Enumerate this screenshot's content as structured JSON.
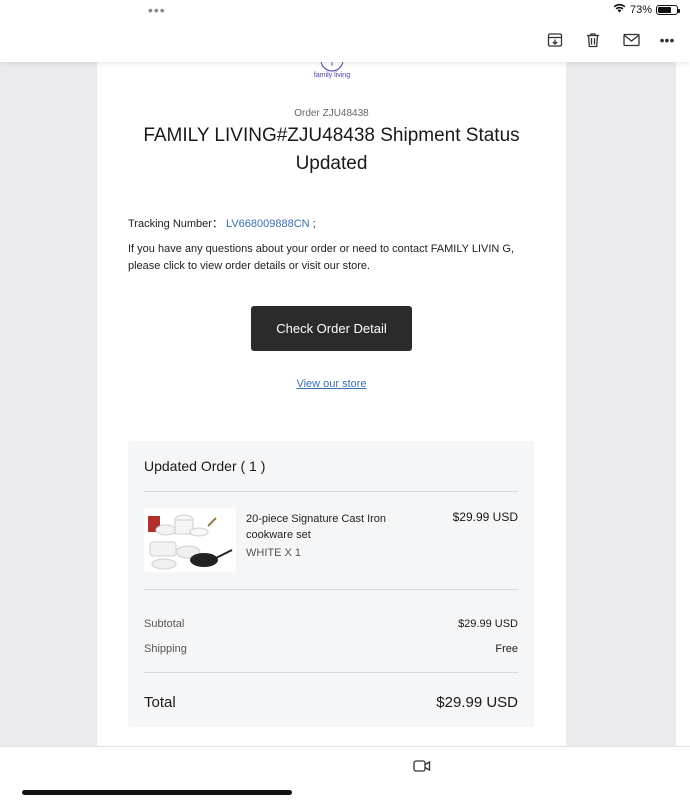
{
  "status_bar": {
    "dots": "•••",
    "battery_percent": "73%",
    "battery_level": 0.73
  },
  "toolbar": {
    "icons": [
      "archive-download-icon",
      "trash-icon",
      "envelope-icon",
      "more-icon"
    ],
    "more_label": "•••"
  },
  "email": {
    "logo_text": "family living",
    "order_line": "Order ZJU48438",
    "title": "FAMILY LIVING#ZJU48438 Shipment Status Updated",
    "tracking_label": "Tracking Number：",
    "tracking_number": "LV668009888CN",
    "tracking_suffix": " ;",
    "paragraph": "If you have any questions about your order or need to contact FAMILY LIVIN G, please click to view order details or visit our store.",
    "button_label": "Check Order Detail",
    "store_link": "View our store"
  },
  "order_card": {
    "title": "Updated Order ( 1 )",
    "item": {
      "name": "20-piece Signature Cast Iron cookware set",
      "price": "$29.99 USD",
      "variant": "WHITE X 1"
    },
    "subtotal_label": "Subtotal",
    "subtotal_value": "$29.99 USD",
    "shipping_label": "Shipping",
    "shipping_value": "Free",
    "total_label": "Total",
    "total_value": "$29.99 USD"
  },
  "bottom_bar": {
    "icons": [
      "video-camera-icon"
    ]
  },
  "colors": {
    "link": "#3a6fb0",
    "button_bg": "#2b2b2b",
    "card_bg": "#f5f6f8",
    "page_bg": "#ebebee",
    "logo": "#4a3ea8"
  }
}
